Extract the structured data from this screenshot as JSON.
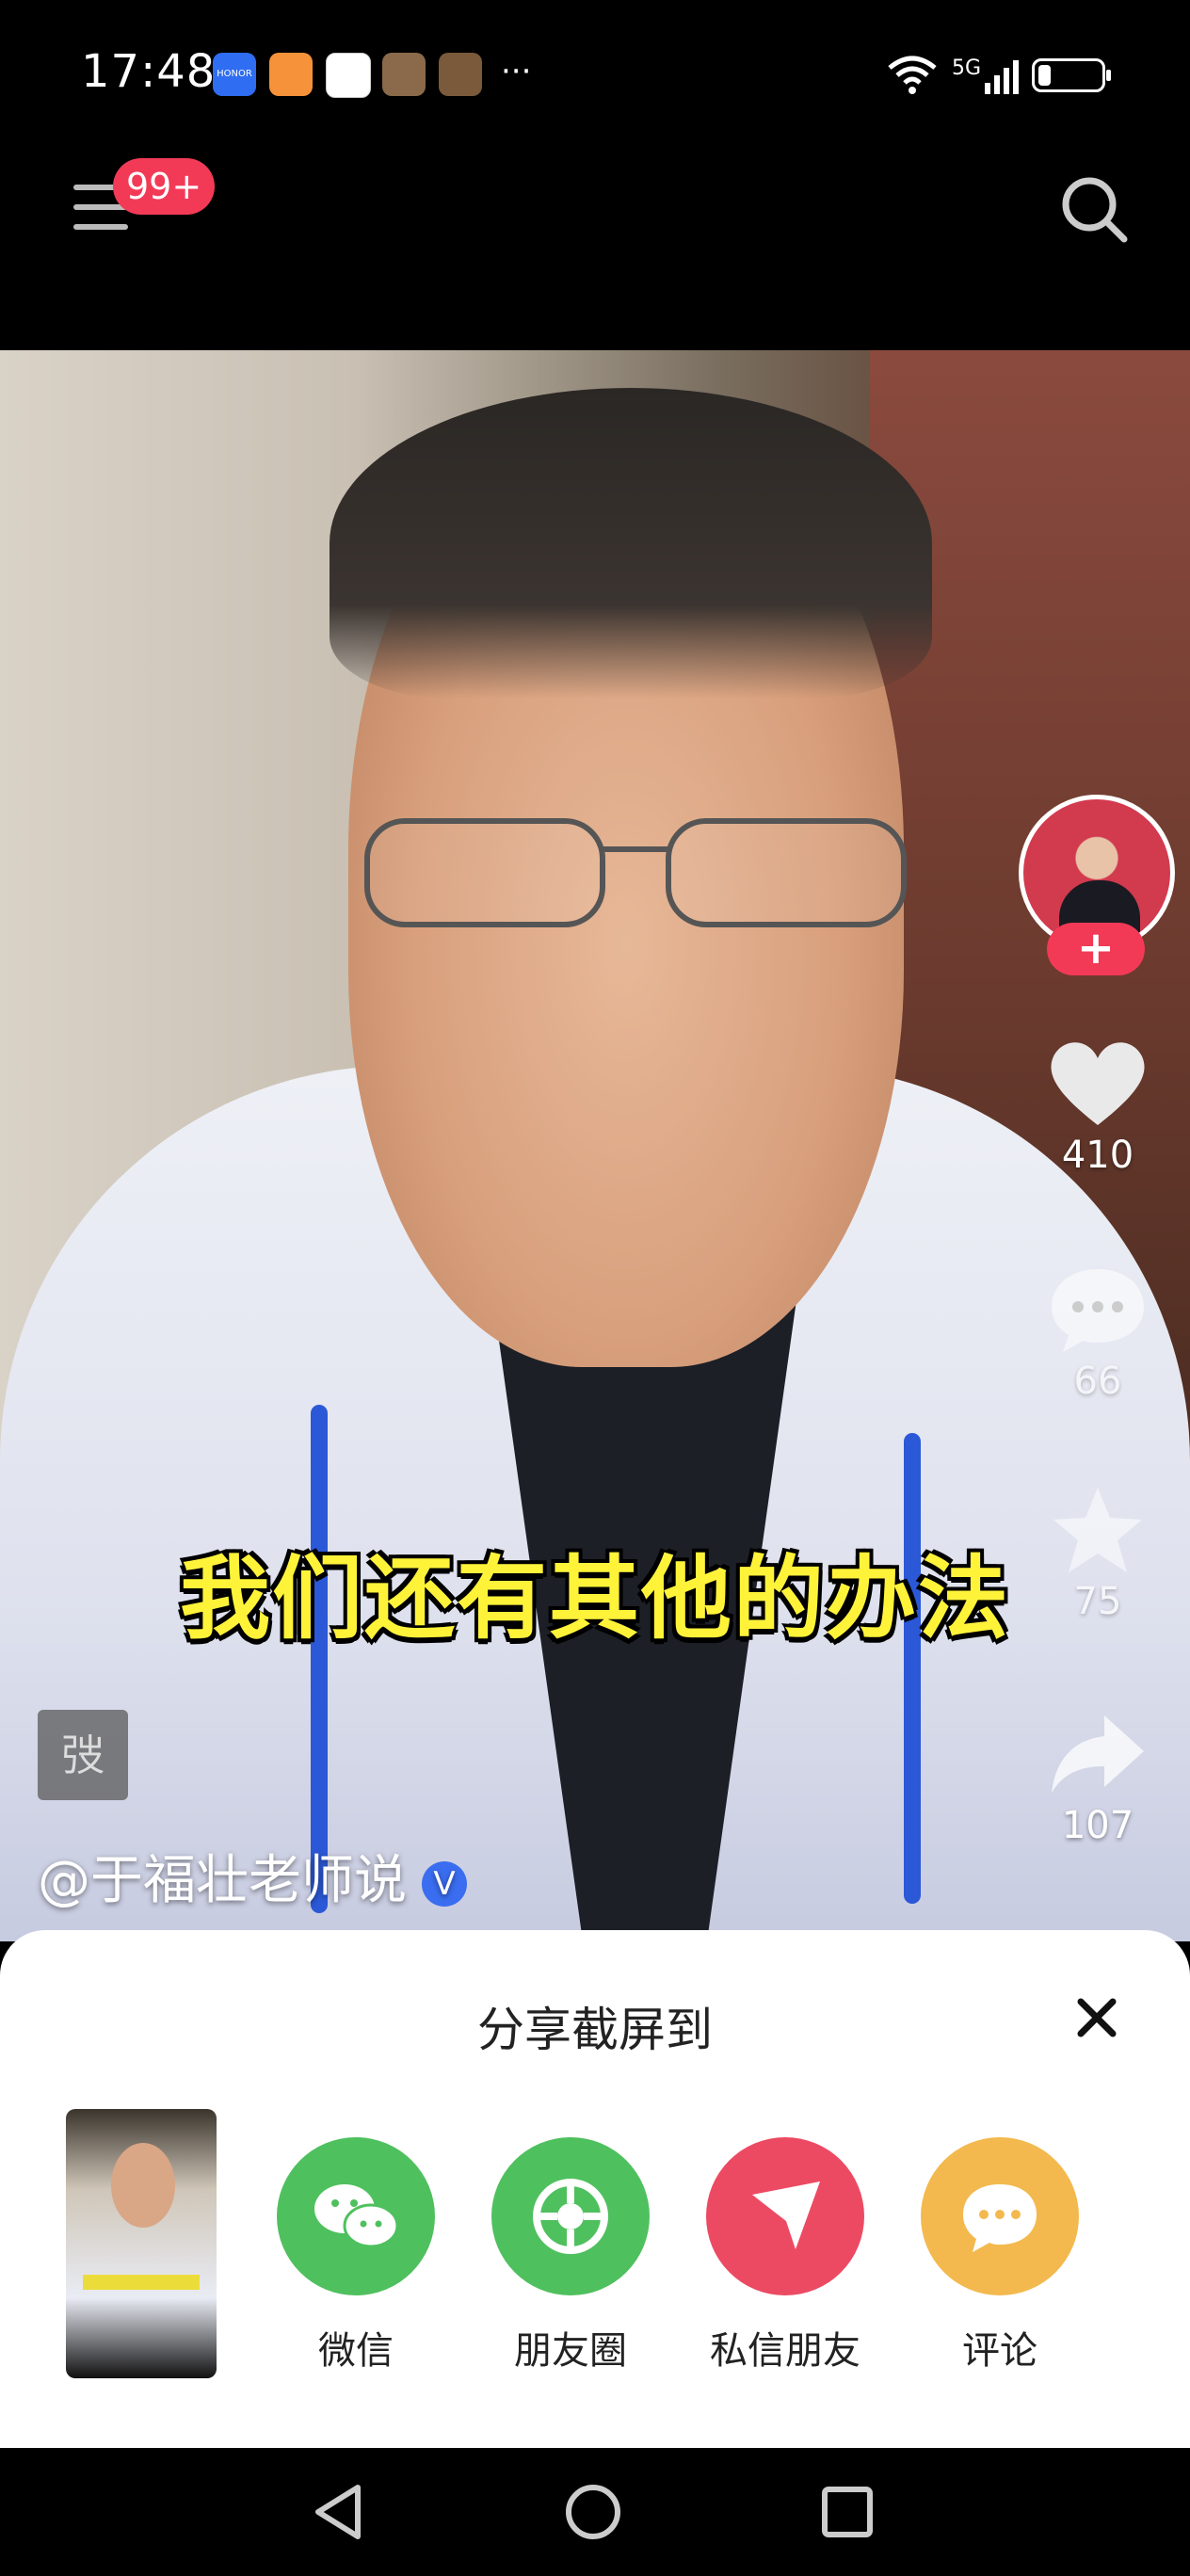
{
  "status_bar": {
    "time": "17:48",
    "network": "5G",
    "more": "···",
    "app_icons": [
      "honor-icon",
      "heart-app-icon",
      "baidu-icon",
      "game-avatar-icon",
      "game-avatar-icon"
    ],
    "battery_level": 0.2
  },
  "top_nav": {
    "notification_badge": "99+"
  },
  "video": {
    "caption": "我们还有其他的办法",
    "author": "@于福壮老师说",
    "author_badge": "弢",
    "verified": "V",
    "likes": "410",
    "comments": "66",
    "favorites": "75",
    "shares": "107"
  },
  "share_sheet": {
    "title": "分享截屏到",
    "options": [
      {
        "label": "微信",
        "color": "#4fc05e",
        "icon": "wechat-icon"
      },
      {
        "label": "朋友圈",
        "color": "#4fc05e",
        "icon": "moments-icon"
      },
      {
        "label": "私信朋友",
        "color": "#ec4a63",
        "icon": "send-icon"
      },
      {
        "label": "评论",
        "color": "#f3b94e",
        "icon": "comment-icon"
      }
    ]
  },
  "colors": {
    "accent": "#f23a57",
    "caption": "#fff33a"
  }
}
